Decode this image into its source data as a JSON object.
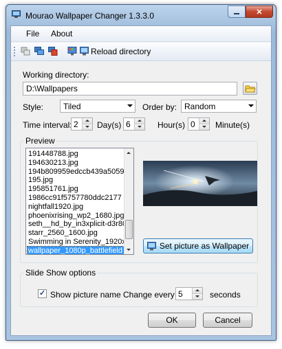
{
  "window": {
    "title": "Mourao Wallpaper Changer 1.3.3.0",
    "close_glyph": "✕"
  },
  "menu": {
    "items": [
      "File",
      "About"
    ]
  },
  "toolbar": {
    "reload_label": "Reload directory",
    "icons": [
      "copy-icon",
      "monitors-icon",
      "stop-icon",
      "display-icon",
      "reload-icon"
    ]
  },
  "working_directory": {
    "label": "Working directory:",
    "value": "D:\\Wallpapers",
    "browse_icon": "folder-icon"
  },
  "style": {
    "label": "Style:",
    "value": "Tiled"
  },
  "order": {
    "label": "Order by:",
    "value": "Random"
  },
  "interval": {
    "label": "Time interval:",
    "days_value": "2",
    "days_label": "Day(s)",
    "hours_value": "6",
    "hours_label": "Hour(s)",
    "minutes_value": "0",
    "minutes_label": "Minute(s)"
  },
  "preview": {
    "title": "Preview",
    "files": [
      "191448788.jpg",
      "194630213.jpg",
      "194b809959edccb439a5059",
      "195.jpg",
      "195851761.jpg",
      "1986cc91f5757780ddc2177",
      "nightfall1920.jpg",
      "phoenixrising_wp2_1680.jpg",
      "seth__hd_by_in3xplicit-d3r80",
      "starr_2560_1600.jpg",
      "Swimming in Serenity_1920x",
      "wallpaper_1080p_battlefield"
    ],
    "selected_file": "wallpaper_1080p_battlefield",
    "set_wallpaper_label": "Set picture as Wallpaper"
  },
  "slideshow": {
    "title": "Slide Show options",
    "show_name_label": "Show picture name",
    "show_name_checked": true,
    "change_every_label": "Change every",
    "change_every_value": "5",
    "seconds_label": "seconds"
  },
  "buttons": {
    "ok": "OK",
    "cancel": "Cancel"
  }
}
